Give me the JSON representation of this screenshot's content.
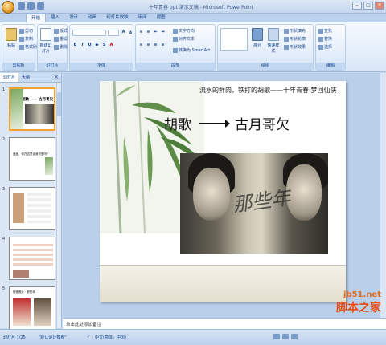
{
  "window": {
    "title": "十年青春 ppt 演示文稿 - Microsoft PowerPoint"
  },
  "ribbon_tabs": [
    "开始",
    "插入",
    "设计",
    "动画",
    "幻灯片放映",
    "审阅",
    "视图"
  ],
  "ribbon": {
    "clipboard": {
      "paste": "粘贴",
      "cut": "剪切",
      "copy": "复制",
      "format_painter": "格式刷",
      "label": "剪贴板"
    },
    "slides": {
      "new_slide": "新建幻灯片",
      "layout": "版式",
      "reset": "重设",
      "delete": "删除",
      "label": "幻灯片"
    },
    "font": {
      "label": "字体"
    },
    "paragraph": {
      "text_direction": "文字方向",
      "align_text": "对齐文本",
      "convert_smartart": "转换为 SmartArt",
      "label": "段落"
    },
    "drawing": {
      "arrange": "排列",
      "quick_styles": "快速样式",
      "shape_fill": "形状填充",
      "shape_outline": "形状轮廓",
      "shape_effects": "形状效果",
      "label": "绘图"
    },
    "editing": {
      "find": "查找",
      "replace": "替换",
      "select": "选择",
      "label": "编辑"
    }
  },
  "left_pane": {
    "tabs": [
      "幻灯片",
      "大纲"
    ],
    "close": "×",
    "thumbnails": [
      {
        "num": "1",
        "text": "胡歌 —— 古月哥欠"
      },
      {
        "num": "2",
        "text": "遥遥，你在这里说我可爱吗？"
      },
      {
        "num": "3",
        "text": ""
      },
      {
        "num": "4",
        "text": ""
      },
      {
        "num": "5",
        "text": "宿舍照片 · 那些年"
      }
    ]
  },
  "slide": {
    "subtitle": "流水的鲜肉，铁打的胡歌——十年青春·梦回仙侠",
    "title_left": "胡歌",
    "title_right": "古月哥欠",
    "calligraphy": "那些年"
  },
  "notes": {
    "placeholder": "单击此处添加备注"
  },
  "status": {
    "slide_count": "幻灯片 1/25",
    "theme": "\"默认设计模板\"",
    "language": "中文(简体，中国)"
  },
  "watermark": {
    "url": "jb51.net",
    "name": "脚本之家"
  },
  "colors": {
    "accent": "#15428b",
    "ribbon_bg": "#d9e7f7",
    "selection": "#f0a030"
  }
}
